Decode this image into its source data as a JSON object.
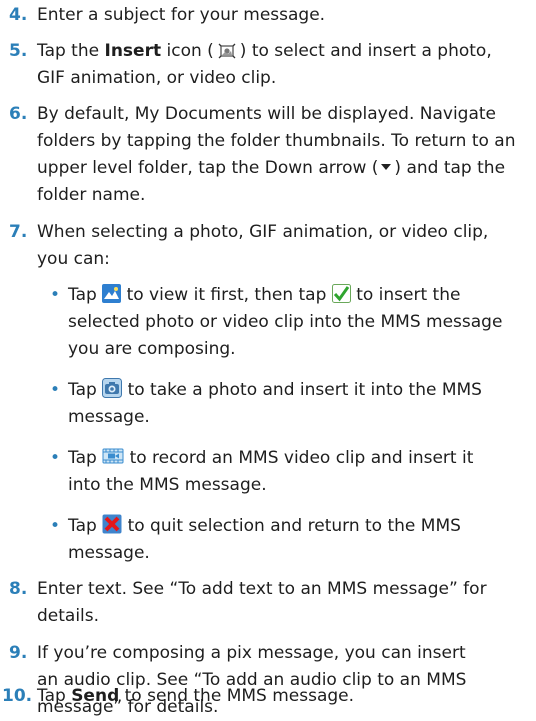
{
  "accent_color": "#2b7fb8",
  "steps": {
    "s4": {
      "num": "4.",
      "text": "Enter a subject for your message."
    },
    "s5": {
      "num": "5.",
      "pre": "Tap the ",
      "bold": "Insert",
      "mid": " icon (",
      "post": ") to select and insert a photo,",
      "line2": "GIF animation, or video clip.",
      "icon": "insert-media-icon"
    },
    "s6": {
      "num": "6.",
      "line1": "By default, My Documents will be displayed. Navigate",
      "line2": "folders by tapping the folder thumbnails. To return to an",
      "line3_pre": "upper level folder, tap the Down arrow (",
      "line3_post": ") and tap the",
      "line4": "folder name.",
      "icon": "down-arrow-icon"
    },
    "s7": {
      "num": "7.",
      "line1": "When selecting a photo, GIF animation, or video clip,",
      "line2": "you can:",
      "bullets": [
        {
          "icon": "view-icon",
          "icon2": "check-icon",
          "pre": "Tap ",
          "mid": " to view it first, then tap ",
          "post": " to insert the",
          "line2": "selected photo or video clip into the MMS message",
          "line3": "you are composing."
        },
        {
          "icon": "camera-icon",
          "pre": "Tap ",
          "post": " to take a photo and insert it into the MMS",
          "line2": "message."
        },
        {
          "icon": "video-camera-icon",
          "pre": "Tap ",
          "post": " to record an MMS video clip and insert it",
          "line2": "into the MMS message."
        },
        {
          "icon": "cancel-icon",
          "pre": "Tap ",
          "post": " to quit selection and return to the MMS",
          "line2": "message."
        }
      ]
    },
    "s8": {
      "num": "8.",
      "line1": "Enter text. See “To add text to an MMS message” for",
      "line2": "details."
    },
    "s9": {
      "num": "9.",
      "line1": "If you’re composing a pix message, you can insert",
      "line2": "an audio clip. See “To add an audio clip to an MMS",
      "line3": "message” for details."
    },
    "s10": {
      "num": "10.",
      "pre": "Tap ",
      "bold": "Send",
      "post": " to send the MMS message."
    }
  },
  "bullet_char": "•"
}
